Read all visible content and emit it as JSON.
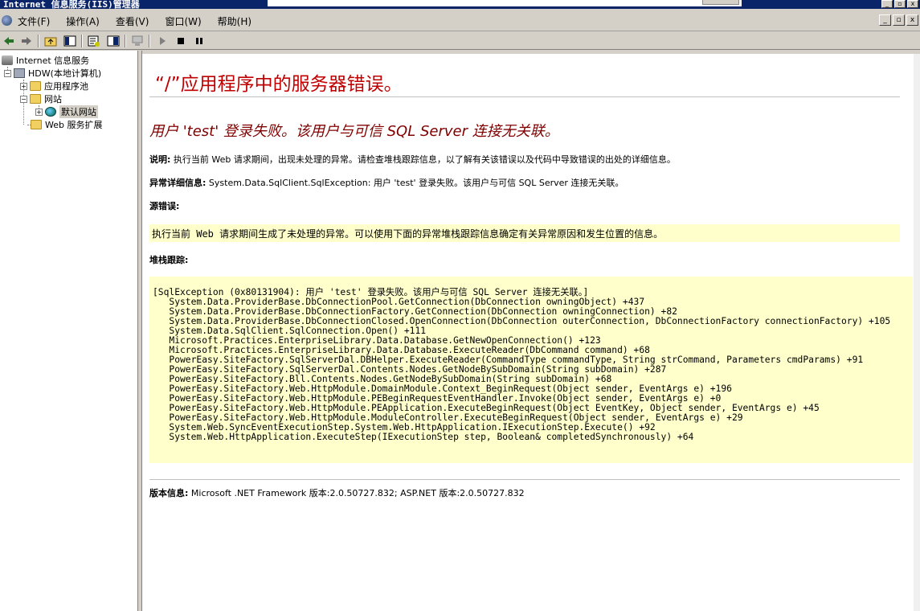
{
  "window": {
    "title": "Internet 信息服务(IIS)管理器",
    "controls": [
      "_",
      "▫",
      "x"
    ]
  },
  "menu": {
    "items": [
      "文件(F)",
      "操作(A)",
      "查看(V)",
      "窗口(W)",
      "帮助(H)"
    ],
    "mdi_controls": [
      "_",
      "▫",
      "x"
    ]
  },
  "tree": {
    "root": "Internet 信息服务",
    "server": "HDW(本地计算机)",
    "app_pools": "应用程序池",
    "websites": "网站",
    "default_site": "默认网站",
    "web_ext": "Web 服务扩展"
  },
  "error": {
    "title": "“/”应用程序中的服务器错误。",
    "subtitle": "用户 'test' 登录失败。该用户与可信 SQL Server 连接无关联。",
    "desc_label": "说明:",
    "desc_text": "执行当前 Web 请求期间，出现未处理的异常。请检查堆栈跟踪信息，以了解有关该错误以及代码中导致错误的出处的详细信息。",
    "exception_label": "异常详细信息:",
    "exception_text": "System.Data.SqlClient.SqlException: 用户 'test' 登录失败。该用户与可信 SQL Server 连接无关联。",
    "source_label": "源错误:",
    "source_text": "执行当前 Web 请求期间生成了未处理的异常。可以使用下面的异常堆栈跟踪信息确定有关异常原因和发生位置的信息。",
    "stack_label": "堆栈跟踪:",
    "stack_trace": "[SqlException (0x80131904): 用户 'test' 登录失败。该用户与可信 SQL Server 连接无关联。]\n   System.Data.ProviderBase.DbConnectionPool.GetConnection(DbConnection owningObject) +437\n   System.Data.ProviderBase.DbConnectionFactory.GetConnection(DbConnection owningConnection) +82\n   System.Data.ProviderBase.DbConnectionClosed.OpenConnection(DbConnection outerConnection, DbConnectionFactory connectionFactory) +105\n   System.Data.SqlClient.SqlConnection.Open() +111\n   Microsoft.Practices.EnterpriseLibrary.Data.Database.GetNewOpenConnection() +123\n   Microsoft.Practices.EnterpriseLibrary.Data.Database.ExecuteReader(DbCommand command) +68\n   PowerEasy.SiteFactory.SqlServerDal.DBHelper.ExecuteReader(CommandType commandType, String strCommand, Parameters cmdParams) +91\n   PowerEasy.SiteFactory.SqlServerDal.Contents.Nodes.GetNodeBySubDomain(String subDomain) +287\n   PowerEasy.SiteFactory.Bll.Contents.Nodes.GetNodeBySubDomain(String subDomain) +68\n   PowerEasy.SiteFactory.Web.HttpModule.DomainModule.Context_BeginRequest(Object sender, EventArgs e) +196\n   PowerEasy.SiteFactory.Web.HttpModule.PEBeginRequestEventHandler.Invoke(Object sender, EventArgs e) +0\n   PowerEasy.SiteFactory.Web.HttpModule.PEApplication.ExecuteBeginRequest(Object EventKey, Object sender, EventArgs e) +45\n   PowerEasy.SiteFactory.Web.HttpModule.ModuleController.ExecuteBeginRequest(Object sender, EventArgs e) +29\n   System.Web.SyncEventExecutionStep.System.Web.HttpApplication.IExecutionStep.Execute() +92\n   System.Web.HttpApplication.ExecuteStep(IExecutionStep step, Boolean& completedSynchronously) +64",
    "version_label": "版本信息:",
    "version_text": "Microsoft .NET Framework 版本:2.0.50727.832; ASP.NET 版本:2.0.50727.832"
  },
  "colors": {
    "title_red": "#c00000",
    "subtitle_maroon": "#800000",
    "code_bg": "#ffffcc"
  }
}
